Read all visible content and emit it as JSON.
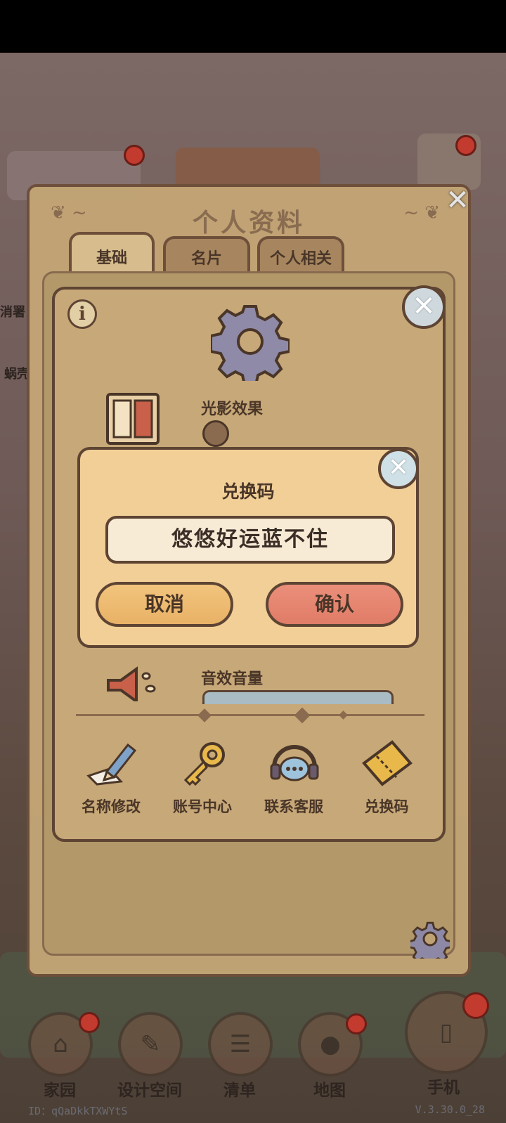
{
  "profile_panel": {
    "title": "个人资料",
    "tabs": [
      {
        "label": "基础"
      },
      {
        "label": "名片"
      },
      {
        "label": "个人相关"
      }
    ]
  },
  "settings": {
    "lighting_label": "光影效果",
    "sound_label": "音效音量",
    "actions": [
      {
        "label": "名称修改",
        "icon": "pencil-icon"
      },
      {
        "label": "账号中心",
        "icon": "key-icon"
      },
      {
        "label": "联系客服",
        "icon": "headset-icon"
      },
      {
        "label": "兑换码",
        "icon": "ticket-icon"
      }
    ]
  },
  "redeem": {
    "title": "兑换码",
    "input_value": "悠悠好运蓝不住",
    "cancel_label": "取消",
    "confirm_label": "确认"
  },
  "bottom_nav": [
    {
      "label": "家园"
    },
    {
      "label": "设计空间"
    },
    {
      "label": "清单"
    },
    {
      "label": "地图"
    },
    {
      "label": "手机"
    }
  ],
  "footer": {
    "id_text": "ID：qQaDkkTXWYtS",
    "version_text": "V.3.30.0_28"
  },
  "side_labels": {
    "left_1": "消署",
    "left_2": "蜗壳"
  },
  "colors": {
    "panel_bg": "#c2a475",
    "dialog_bg": "#f2cf97",
    "cancel_btn": "#e8b266",
    "confirm_btn": "#e07c68",
    "outline": "#5e4433"
  }
}
